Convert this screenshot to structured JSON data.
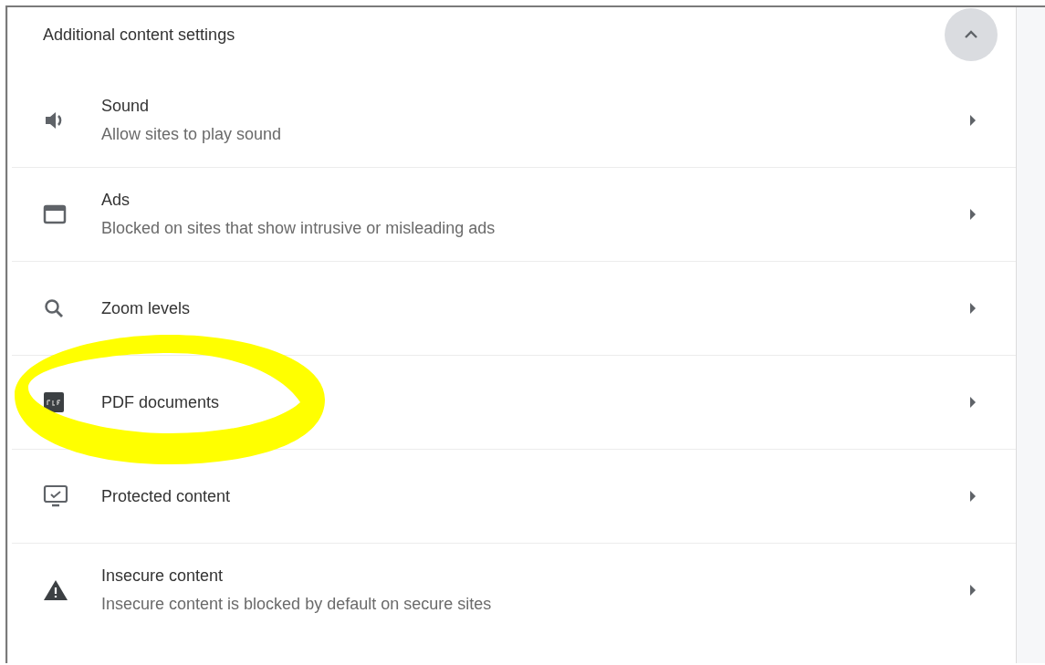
{
  "section": {
    "title": "Additional content settings",
    "expanded": true
  },
  "items": [
    {
      "kind": "sound",
      "title": "Sound",
      "description": "Allow sites to play sound",
      "highlighted": false
    },
    {
      "kind": "ads",
      "title": "Ads",
      "description": "Blocked on sites that show intrusive or misleading ads",
      "highlighted": false
    },
    {
      "kind": "zoom",
      "title": "Zoom levels",
      "highlighted": false
    },
    {
      "kind": "pdf",
      "title": "PDF documents",
      "highlighted": true
    },
    {
      "kind": "protected",
      "title": "Protected content",
      "highlighted": false
    },
    {
      "kind": "insecure",
      "title": "Insecure content",
      "description": "Insecure content is blocked by default on secure sites",
      "highlighted": false
    }
  ]
}
